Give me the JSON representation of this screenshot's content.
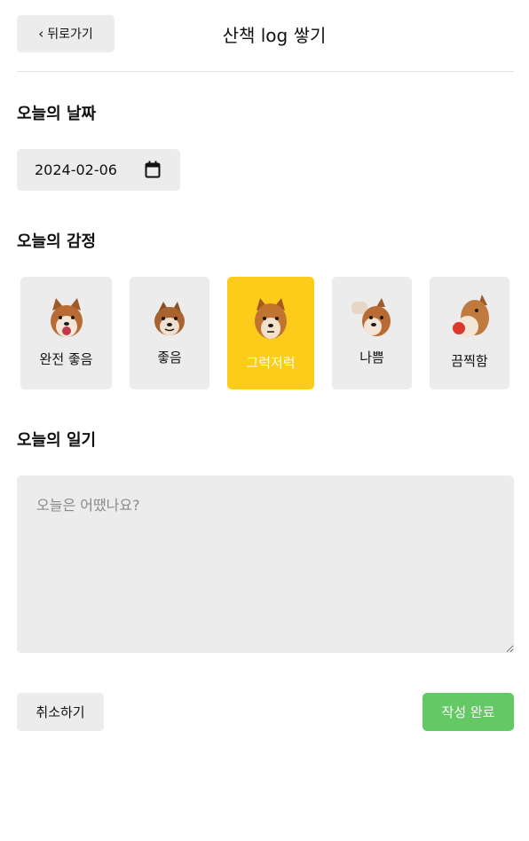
{
  "header": {
    "back_label": "뒤로가기",
    "title": "산책 log 쌓기"
  },
  "date_section": {
    "title": "오늘의 날짜",
    "value": "2024-02-06"
  },
  "emotion_section": {
    "title": "오늘의 감정",
    "items": [
      {
        "label": "완전 좋음",
        "icon": "shiba-happy-icon"
      },
      {
        "label": "좋음",
        "icon": "shiba-good-icon"
      },
      {
        "label": "그럭저럭",
        "icon": "shiba-okay-icon"
      },
      {
        "label": "나쁨",
        "icon": "shiba-bad-icon"
      },
      {
        "label": "끔찍함",
        "icon": "shiba-terrible-icon"
      }
    ],
    "selected_index": 2
  },
  "diary_section": {
    "title": "오늘의 일기",
    "placeholder": "오늘은 어땠나요?",
    "value": ""
  },
  "actions": {
    "cancel_label": "취소하기",
    "submit_label": "작성 완료"
  },
  "colors": {
    "selected": "#fdcb1a",
    "submit": "#64c964",
    "field_bg": "#ececec"
  }
}
